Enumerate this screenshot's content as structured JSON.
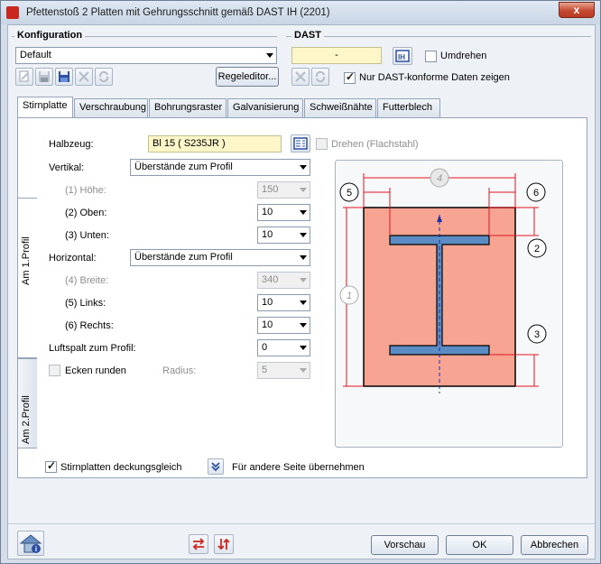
{
  "window": {
    "title": "Pfettenstoß 2 Platten mit Gehrungsschnitt gemäß DAST IH (2201)",
    "close_label": "x"
  },
  "konfiguration": {
    "title": "Konfiguration",
    "selected": "Default",
    "regeleditor_label": "Regeleditor..."
  },
  "dast": {
    "title": "DAST",
    "value": "-",
    "ih_label": "IH",
    "umdrehen_label": "Umdrehen",
    "nur_dast_label": "Nur DAST-konforme Daten zeigen",
    "umdrehen_checked": false,
    "nur_dast_checked": true
  },
  "tabs": [
    "Stirnplatte",
    "Verschraubung",
    "Bohrungsraster",
    "Galvanisierung",
    "Schweißnähte",
    "Futterblech"
  ],
  "side_tabs": [
    "Am 1.Profil",
    "Am 2.Profil"
  ],
  "form": {
    "halbzeug_label": "Halbzeug:",
    "halbzeug_value": "Bl 15  ( S235JR )",
    "drehen_label": "Drehen (Flachstahl)",
    "vertikal_label": "Vertikal:",
    "vertikal_value": "Überstände zum Profil",
    "hoehe_label": "(1) Höhe:",
    "hoehe_value": "150",
    "oben_label": "(2) Oben:",
    "oben_value": "10",
    "unten_label": "(3) Unten:",
    "unten_value": "10",
    "horizontal_label": "Horizontal:",
    "horizontal_value": "Überstände zum Profil",
    "breite_label": "(4) Breite:",
    "breite_value": "340",
    "links_label": "(5) Links:",
    "links_value": "10",
    "rechts_label": "(6) Rechts:",
    "rechts_value": "10",
    "luftspalt_label": "Luftspalt zum Profil:",
    "luftspalt_value": "0",
    "ecken_label": "Ecken runden",
    "radius_label": "Radius:",
    "radius_value": "5"
  },
  "drawing": {
    "markers": [
      "1",
      "2",
      "3",
      "4",
      "5",
      "6"
    ],
    "colors": {
      "plate": "#f8a493",
      "profile": "#5b8cc4",
      "dim": "#e0141e"
    }
  },
  "bottom": {
    "deckungsgleich_label": "Stirnplatten deckungsgleich",
    "uebernehmen_label": "Für andere Seite übernehmen",
    "vorschau_label": "Vorschau",
    "ok_label": "OK",
    "abbrechen_label": "Abbrechen"
  }
}
